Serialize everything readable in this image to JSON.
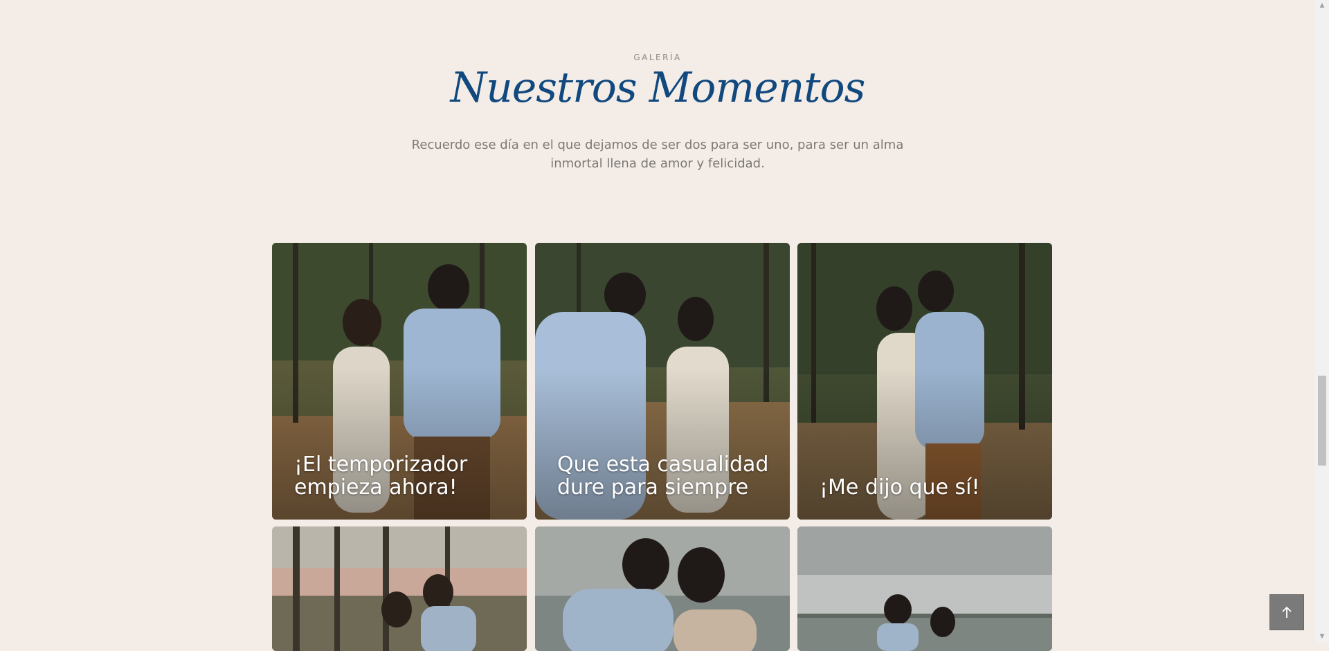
{
  "gallery": {
    "eyebrow": "GALERÍA",
    "title": "Nuestros Momentos",
    "description": "Recuerdo ese día en el que dejamos de ser dos para ser uno, para ser un alma inmortal llena de amor y felicidad."
  },
  "cards": [
    {
      "caption": "¡El temporizador empieza ahora!"
    },
    {
      "caption": "Que esta casualidad dure para siempre"
    },
    {
      "caption": "¡Me dijo que sí!"
    },
    {
      "caption": ""
    },
    {
      "caption": ""
    },
    {
      "caption": ""
    }
  ],
  "icons": {
    "back_to_top": "arrow-up-icon"
  },
  "colors": {
    "background": "#f4ede7",
    "title": "#11497f",
    "text_muted": "#7d7875",
    "button": "#7a7a7a"
  }
}
